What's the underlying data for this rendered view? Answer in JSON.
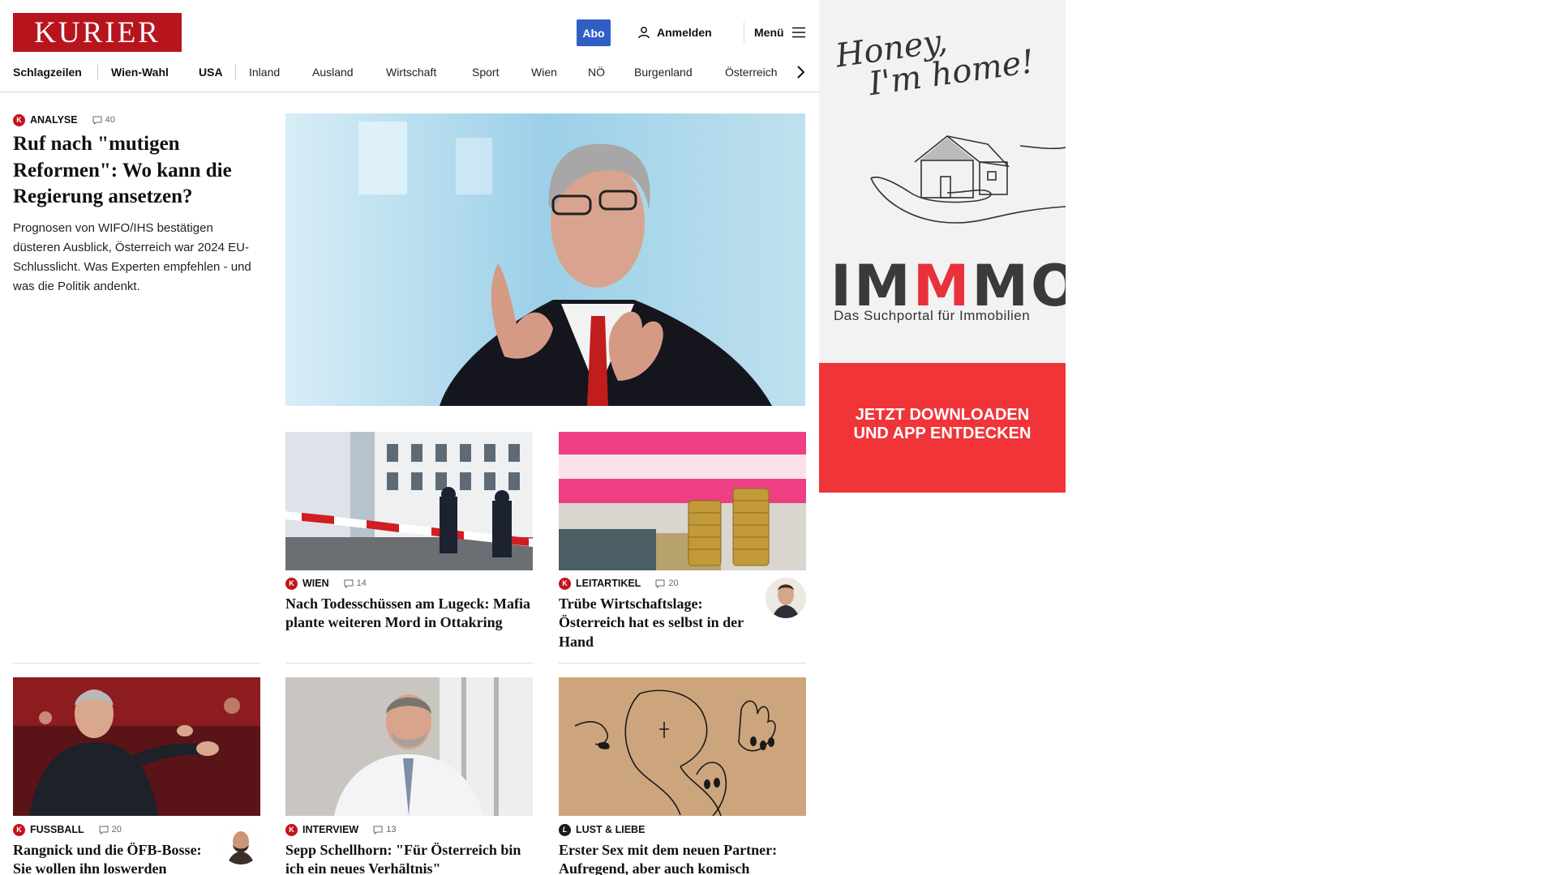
{
  "header": {
    "logo": "KURIER",
    "abo_label": "Abo",
    "login_label": "Anmelden",
    "menu_label": "Menü"
  },
  "nav": {
    "items": [
      "Schlagzeilen",
      "Wien-Wahl",
      "USA",
      "Inland",
      "Ausland",
      "Wirtschaft",
      "Sport",
      "Wien",
      "NÖ",
      "Burgenland",
      "Österreich"
    ]
  },
  "lead": {
    "kicker": "ANALYSE",
    "comments": "40",
    "headline": "Ruf nach \"mutigen Reformen\": Wo kann die Regierung ansetzen?",
    "teaser": "Prognosen von WIFO/IHS bestätigen düsteren Ausblick, Österreich war 2024 EU-Schlusslicht. Was Experten empfehlen - und was die Politik andenkt."
  },
  "articles": [
    {
      "kicker": "WIEN",
      "comments": "14",
      "headline": "Nach Todesschüssen am Lugeck: Mafia plante weiteren Mord in Ottakring"
    },
    {
      "kicker": "LEITARTIKEL",
      "comments": "20",
      "headline": "Trübe Wirtschaftslage: Österreich hat es selbst in der Hand"
    },
    {
      "kicker": "FUSSBALL",
      "comments": "20",
      "headline": "Rangnick und die ÖFB-Bosse: Sie wollen ihn loswerden"
    },
    {
      "kicker": "INTERVIEW",
      "comments": "13",
      "headline": "Sepp Schellhorn: \"Für Österreich bin ich ein neues Verhältnis\""
    },
    {
      "kicker": "LUST & LIEBE",
      "comments": "",
      "headline": "Erster Sex mit dem neuen Partner: Aufregend, aber auch komisch"
    }
  ],
  "ad": {
    "script_line1": "Honey,",
    "script_line2": "I'm home!",
    "brand_a": "IM",
    "brand_m": "M",
    "brand_b": "MO",
    "subline": "Das Suchportal für Immobilien",
    "cta_line1": "JETZT DOWNLOADEN",
    "cta_line2": "UND APP ENTDECKEN"
  },
  "colors": {
    "brand_red": "#b8141e",
    "abo_blue": "#2f5fc5",
    "ad_red": "#f03438"
  }
}
